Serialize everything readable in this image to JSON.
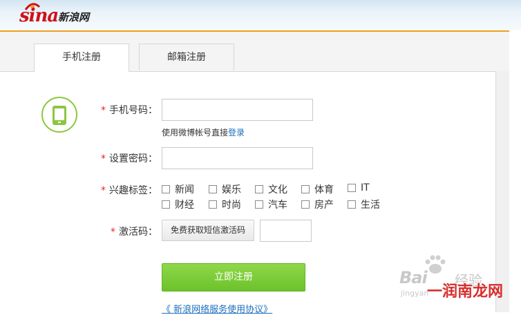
{
  "header": {
    "logo_word": "sina",
    "logo_cn": "新浪网"
  },
  "tabs": [
    {
      "label": "手机注册",
      "active": true
    },
    {
      "label": "邮箱注册",
      "active": false
    }
  ],
  "form": {
    "phone": {
      "star": "*",
      "label": "手机号码：",
      "value": ""
    },
    "hint": {
      "text": "使用微博帐号直接",
      "link": "登录"
    },
    "password": {
      "star": "*",
      "label": "设置密码：",
      "value": ""
    },
    "interests": {
      "star": "*",
      "label": "兴趣标签：",
      "options": [
        "新闻",
        "娱乐",
        "文化",
        "体育",
        "IT",
        "财经",
        "时尚",
        "汽车",
        "房产",
        "生活"
      ]
    },
    "activation": {
      "star": "*",
      "label": "激活码：",
      "sms_button": "免费获取短信激活码",
      "value": ""
    }
  },
  "register_button": "立即注册",
  "agreement_link": "《 新浪网络服务使用协议》",
  "watermark": {
    "bai": "Bai",
    "jy": "经验",
    "jingyan": "jingyan",
    "brand": "一润南龙网"
  },
  "colors": {
    "accent_green": "#7ccc38",
    "link_blue": "#1a6fbd",
    "required_red": "#e22222",
    "brand_red": "#d01018"
  },
  "icons": {
    "form_icon": "mobile-phone-icon"
  }
}
